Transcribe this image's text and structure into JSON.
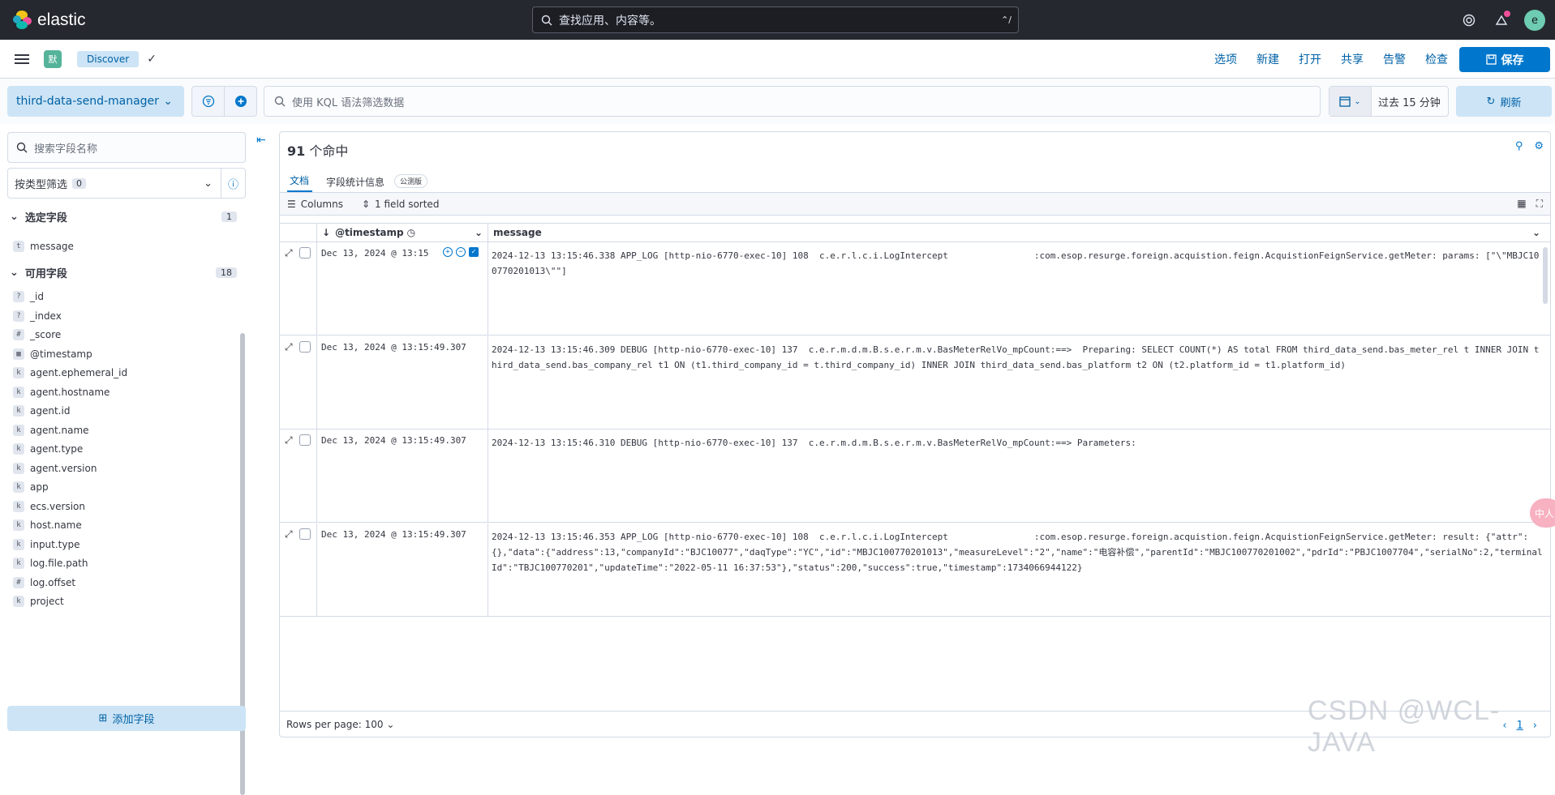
{
  "app": {
    "brand": "elastic",
    "space_badge": "默",
    "avatar": "e"
  },
  "global_search": {
    "placeholder": "查找应用、内容等。",
    "shortcut": "⌃/"
  },
  "breadcrumb": {
    "current": "Discover"
  },
  "top_menu": [
    "选项",
    "新建",
    "打开",
    "共享",
    "告警",
    "检查"
  ],
  "save_label": "保存",
  "data_view": {
    "name": "third-data-send-manager"
  },
  "query": {
    "placeholder": "使用 KQL 语法筛选数据"
  },
  "time_picker": {
    "label": "过去 15 分钟"
  },
  "refresh_label": "刷新",
  "sidebar": {
    "search_placeholder": "搜索字段名称",
    "type_filter_label": "按类型筛选",
    "type_filter_count": "0",
    "selected_title": "选定字段",
    "selected_count": "1",
    "selected_fields": [
      {
        "type": "t",
        "name": "message"
      }
    ],
    "available_title": "可用字段",
    "available_count": "18",
    "available_fields": [
      {
        "type": "?",
        "name": "_id"
      },
      {
        "type": "?",
        "name": "_index"
      },
      {
        "type": "#",
        "name": "_score"
      },
      {
        "type": "cal",
        "name": "@timestamp"
      },
      {
        "type": "k",
        "name": "agent.ephemeral_id"
      },
      {
        "type": "k",
        "name": "agent.hostname"
      },
      {
        "type": "k",
        "name": "agent.id"
      },
      {
        "type": "k",
        "name": "agent.name"
      },
      {
        "type": "k",
        "name": "agent.type"
      },
      {
        "type": "k",
        "name": "agent.version"
      },
      {
        "type": "k",
        "name": "app"
      },
      {
        "type": "k",
        "name": "ecs.version"
      },
      {
        "type": "k",
        "name": "host.name"
      },
      {
        "type": "k",
        "name": "input.type"
      },
      {
        "type": "k",
        "name": "log.file.path"
      },
      {
        "type": "#",
        "name": "log.offset"
      },
      {
        "type": "k",
        "name": "project"
      }
    ],
    "add_field_label": "添加字段"
  },
  "results": {
    "hit_count": "91",
    "hit_suffix": " 个命中",
    "tabs": [
      "文档",
      "字段统计信息"
    ],
    "tech_preview": "公测版",
    "columns_label": "Columns",
    "sorted_label": "1 field sorted",
    "col_timestamp": "@timestamp",
    "col_message": "message",
    "rows": [
      {
        "timestamp": "Dec 13, 2024 @ 13:15",
        "message": "2024-12-13 13:15:46.338 APP_LOG [http-nio-6770-exec-10] 108  c.e.r.l.c.i.LogIntercept                :com.esop.resurge.foreign.acquistion.feign.AcquistionFeignService.getMeter: params: [\"\\\"MBJC100770201013\\\"\"]"
      },
      {
        "timestamp": "Dec 13, 2024 @ 13:15:49.307",
        "message": "2024-12-13 13:15:46.309 DEBUG [http-nio-6770-exec-10] 137  c.e.r.m.d.m.B.s.e.r.m.v.BasMeterRelVo_mpCount:==>  Preparing: SELECT COUNT(*) AS total FROM third_data_send.bas_meter_rel t INNER JOIN third_data_send.bas_company_rel t1 ON (t1.third_company_id = t.third_company_id) INNER JOIN third_data_send.bas_platform t2 ON (t2.platform_id = t1.platform_id)"
      },
      {
        "timestamp": "Dec 13, 2024 @ 13:15:49.307",
        "message": "2024-12-13 13:15:46.310 DEBUG [http-nio-6770-exec-10] 137  c.e.r.m.d.m.B.s.e.r.m.v.BasMeterRelVo_mpCount:==> Parameters:"
      },
      {
        "timestamp": "Dec 13, 2024 @ 13:15:49.307",
        "message": "2024-12-13 13:15:46.353 APP_LOG [http-nio-6770-exec-10] 108  c.e.r.l.c.i.LogIntercept                :com.esop.resurge.foreign.acquistion.feign.AcquistionFeignService.getMeter: result: {\"attr\":{},\"data\":{\"address\":13,\"companyId\":\"BJC10077\",\"daqType\":\"YC\",\"id\":\"MBJC100770201013\",\"measureLevel\":\"2\",\"name\":\"电容补偿\",\"parentId\":\"MBJC100770201002\",\"pdrId\":\"PBJC1007704\",\"serialNo\":2,\"terminalId\":\"TBJC100770201\",\"updateTime\":\"2022-05-11 16:37:53\"},\"status\":200,\"success\":true,\"timestamp\":1734066944122}"
      }
    ],
    "rows_per_page": "Rows per page: 100",
    "page": "1"
  },
  "watermark": "CSDN @WCL-JAVA",
  "float_button": "中人"
}
